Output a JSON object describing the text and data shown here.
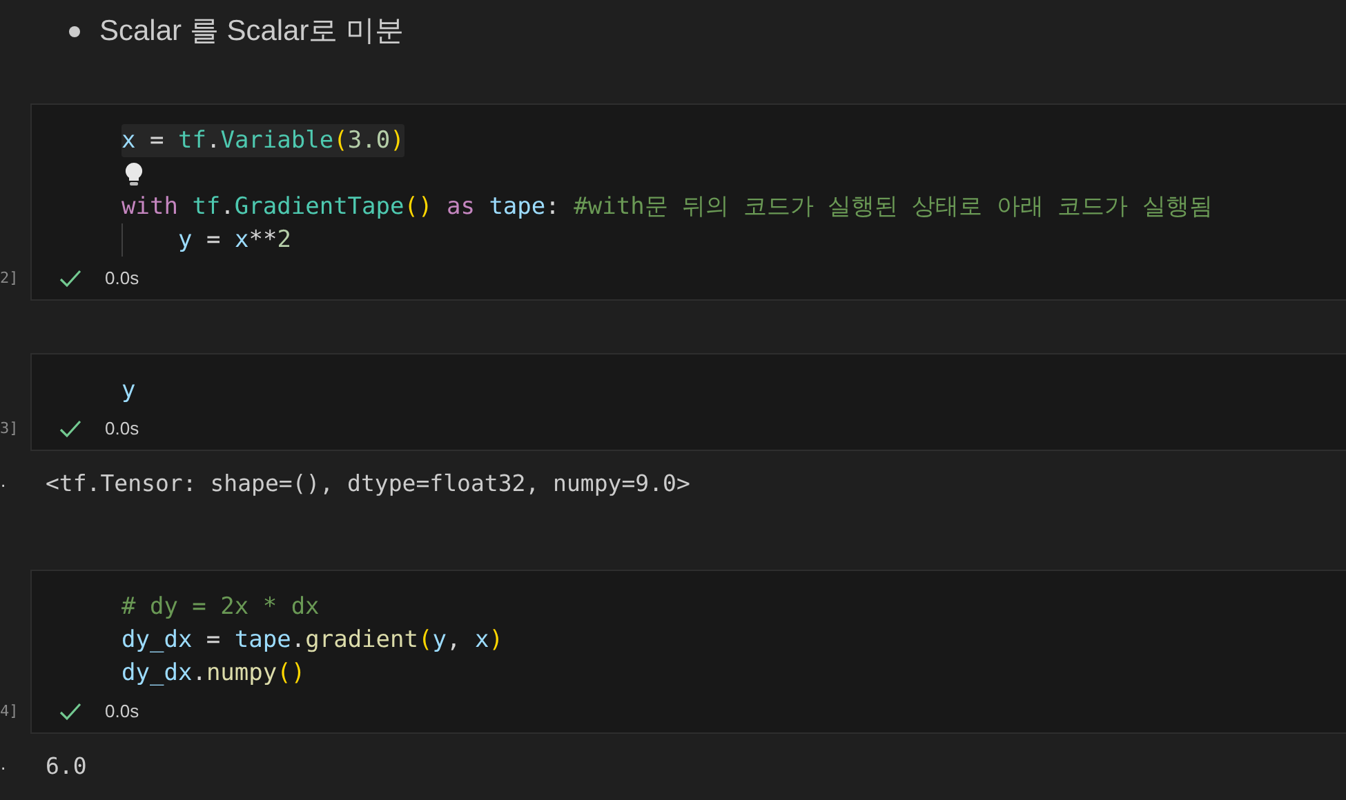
{
  "heading": {
    "text": "Scalar 를 Scalar로 미분"
  },
  "cells": [
    {
      "execution_count": "2]",
      "success": true,
      "time": "0.0s",
      "lines": [
        {
          "kind": "code",
          "current": true,
          "indent": false,
          "tokens": [
            {
              "kind": "var",
              "t": "x"
            },
            {
              "kind": "plain",
              "t": " = "
            },
            {
              "kind": "type",
              "t": "tf"
            },
            {
              "kind": "plain",
              "t": "."
            },
            {
              "kind": "type",
              "t": "Variable"
            },
            {
              "kind": "paren",
              "t": "("
            },
            {
              "kind": "num",
              "t": "3.0"
            },
            {
              "kind": "paren",
              "t": ")"
            }
          ]
        },
        {
          "kind": "hint"
        },
        {
          "kind": "code",
          "current": false,
          "indent": false,
          "tokens": [
            {
              "kind": "kw",
              "t": "with"
            },
            {
              "kind": "type",
              "t": " tf"
            },
            {
              "kind": "plain",
              "t": "."
            },
            {
              "kind": "type",
              "t": "GradientTape"
            },
            {
              "kind": "paren",
              "t": "()"
            },
            {
              "kind": "kw",
              "t": " as"
            },
            {
              "kind": "var",
              "t": " tape"
            },
            {
              "kind": "plain",
              "t": ": "
            },
            {
              "kind": "comment",
              "t": "#with문 뒤의 코드가 실행된 상태로 아래 코드가 실행됨"
            }
          ]
        },
        {
          "kind": "code",
          "current": false,
          "indent": true,
          "tokens": [
            {
              "kind": "var",
              "t": "y"
            },
            {
              "kind": "plain",
              "t": " = "
            },
            {
              "kind": "var",
              "t": "x"
            },
            {
              "kind": "plain",
              "t": "**"
            },
            {
              "kind": "num",
              "t": "2"
            }
          ]
        }
      ]
    },
    {
      "execution_count": "3]",
      "success": true,
      "time": "0.0s",
      "output": {
        "marker": "·",
        "text": "<tf.Tensor: shape=(), dtype=float32, numpy=9.0>"
      },
      "lines": [
        {
          "kind": "code",
          "current": false,
          "indent": false,
          "tokens": [
            {
              "kind": "var",
              "t": "y"
            }
          ]
        }
      ]
    },
    {
      "execution_count": "4]",
      "success": true,
      "time": "0.0s",
      "output": {
        "marker": "·",
        "text": "6.0"
      },
      "lines": [
        {
          "kind": "code",
          "current": false,
          "indent": false,
          "tokens": [
            {
              "kind": "comment",
              "t": "# dy = 2x * dx"
            }
          ]
        },
        {
          "kind": "code",
          "current": false,
          "indent": false,
          "tokens": [
            {
              "kind": "var",
              "t": "dy_dx"
            },
            {
              "kind": "plain",
              "t": " = "
            },
            {
              "kind": "var",
              "t": "tape"
            },
            {
              "kind": "plain",
              "t": "."
            },
            {
              "kind": "fn",
              "t": "gradient"
            },
            {
              "kind": "paren",
              "t": "("
            },
            {
              "kind": "var",
              "t": "y"
            },
            {
              "kind": "plain",
              "t": ", "
            },
            {
              "kind": "var",
              "t": "x"
            },
            {
              "kind": "paren",
              "t": ")"
            }
          ]
        },
        {
          "kind": "code",
          "current": false,
          "indent": false,
          "tokens": [
            {
              "kind": "var",
              "t": "dy_dx"
            },
            {
              "kind": "plain",
              "t": "."
            },
            {
              "kind": "fn",
              "t": "numpy"
            },
            {
              "kind": "paren",
              "t": "()"
            }
          ]
        }
      ]
    }
  ]
}
